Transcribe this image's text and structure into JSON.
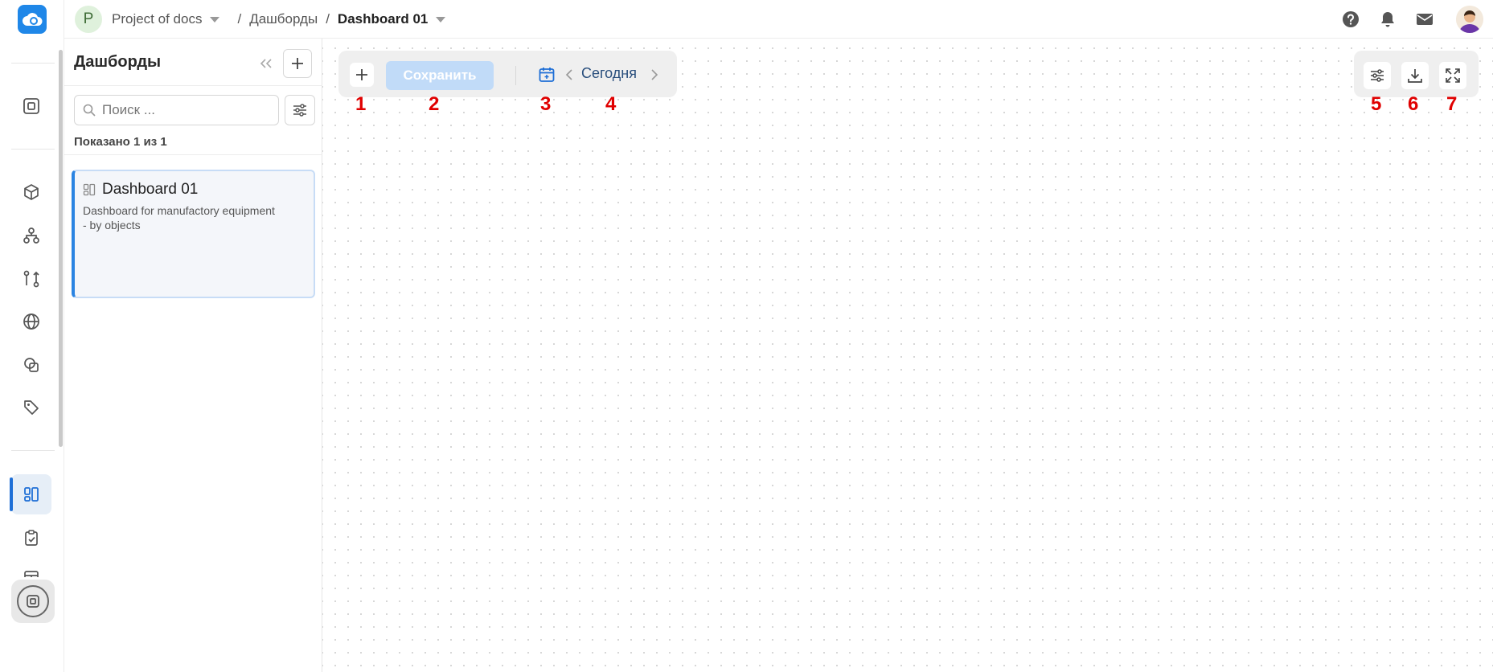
{
  "header": {
    "project_initial": "P",
    "project_name": "Project of docs",
    "separator": "/",
    "section": "Дашборды",
    "current": "Dashboard 01"
  },
  "sidebar": {
    "title": "Дашборды",
    "search_placeholder": "Поиск ...",
    "shown_text": "Показано 1 из 1",
    "cards": [
      {
        "title": "Dashboard 01",
        "description": "Dashboard for manufactory equipment - by objects"
      }
    ]
  },
  "toolbar": {
    "save_label": "Сохранить",
    "date_label": "Сегодня"
  },
  "markers": [
    "1",
    "2",
    "3",
    "4",
    "5",
    "6",
    "7"
  ],
  "colors": {
    "accent": "#1f87e8",
    "save_button": "#c1dbf8",
    "marker": "#e00000",
    "active_rail": "#1f6fd6"
  },
  "icons": {
    "rail": [
      "cloud-logo-icon",
      "object-icon",
      "cube-icon",
      "hierarchy-icon",
      "git-compare-icon",
      "globe-icon",
      "shapes-icon",
      "tag-icon",
      "dashboard-icon",
      "clipboard-check-icon",
      "table-icon",
      "target-icon"
    ],
    "top": [
      "help-icon",
      "bell-icon",
      "mail-icon",
      "user-avatar"
    ],
    "toolbar": [
      "plus-icon",
      "calendar-icon",
      "chevron-left-icon",
      "chevron-right-icon",
      "sliders-icon",
      "download-icon",
      "fullscreen-icon"
    ]
  }
}
